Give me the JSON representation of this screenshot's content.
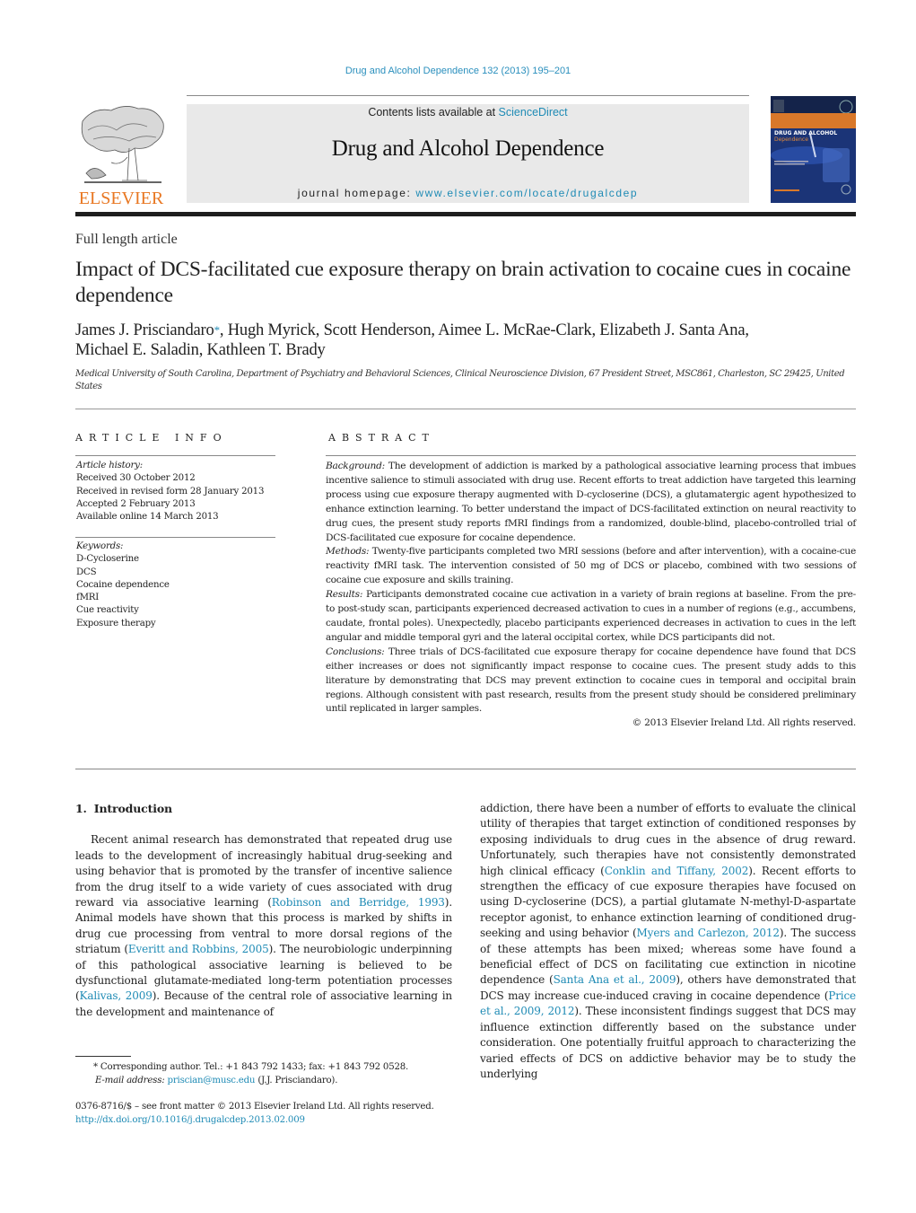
{
  "header": {
    "citation": "Drug and Alcohol Dependence 132 (2013) 195–201",
    "contents_prefix": "Contents lists available at ",
    "contents_link": "ScienceDirect",
    "journal_title": "Drug and Alcohol Dependence",
    "homepage_prefix": "journal homepage: ",
    "homepage_link": "www.elsevier.com/locate/drugalcdep",
    "publisher_logo_text": "ELSEVIER",
    "cover": {
      "title_line1": "DRUG AND ALCOHOL",
      "title_line2": "Dependence",
      "colors": {
        "band": "#d9782a",
        "background": "#13244a"
      }
    }
  },
  "article": {
    "type": "Full length article",
    "title": "Impact of DCS-facilitated cue exposure therapy on brain activation to cocaine cues in cocaine dependence",
    "authors": [
      {
        "name": "James J. Prisciandaro",
        "mark": "*"
      },
      {
        "name": "Hugh Myrick"
      },
      {
        "name": "Scott Henderson"
      },
      {
        "name": "Aimee L. McRae-Clark"
      },
      {
        "name": "Elizabeth J. Santa Ana"
      },
      {
        "name": "Michael E. Saladin"
      },
      {
        "name": "Kathleen T. Brady"
      }
    ],
    "affiliation": "Medical University of South Carolina, Department of Psychiatry and Behavioral Sciences, Clinical Neuroscience Division, 67 President Street, MSC861, Charleston, SC 29425, United States"
  },
  "article_info": {
    "heading": "ARTICLE INFO",
    "history_label": "Article history:",
    "history": [
      "Received 30 October 2012",
      "Received in revised form 28 January 2013",
      "Accepted 2 February 2013",
      "Available online 14 March 2013"
    ],
    "keywords_label": "Keywords:",
    "keywords": [
      "D-Cycloserine",
      "DCS",
      "Cocaine dependence",
      "fMRI",
      "Cue reactivity",
      "Exposure therapy"
    ]
  },
  "abstract": {
    "heading": "ABSTRACT",
    "sections": [
      {
        "label": "Background:",
        "text": " The development of addiction is marked by a pathological associative learning process that imbues incentive salience to stimuli associated with drug use. Recent efforts to treat addiction have targeted this learning process using cue exposure therapy augmented with D-cycloserine (DCS), a glutamatergic agent hypothesized to enhance extinction learning. To better understand the impact of DCS-facilitated extinction on neural reactivity to drug cues, the present study reports fMRI findings from a randomized, double-blind, placebo-controlled trial of DCS-facilitated cue exposure for cocaine dependence."
      },
      {
        "label": "Methods:",
        "text": " Twenty-five participants completed two MRI sessions (before and after intervention), with a cocaine-cue reactivity fMRI task. The intervention consisted of 50 mg of DCS or placebo, combined with two sessions of cocaine cue exposure and skills training."
      },
      {
        "label": "Results:",
        "text": " Participants demonstrated cocaine cue activation in a variety of brain regions at baseline. From the pre- to post-study scan, participants experienced decreased activation to cues in a number of regions (e.g., accumbens, caudate, frontal poles). Unexpectedly, placebo participants experienced decreases in activation to cues in the left angular and middle temporal gyri and the lateral occipital cortex, while DCS participants did not."
      },
      {
        "label": "Conclusions:",
        "text": " Three trials of DCS-facilitated cue exposure therapy for cocaine dependence have found that DCS either increases or does not significantly impact response to cocaine cues. The present study adds to this literature by demonstrating that DCS may prevent extinction to cocaine cues in temporal and occipital brain regions. Although consistent with past research, results from the present study should be considered preliminary until replicated in larger samples."
      }
    ],
    "copyright": "© 2013 Elsevier Ireland Ltd. All rights reserved."
  },
  "body": {
    "section_number": "1.",
    "section_title": "Introduction",
    "left_column": [
      {
        "t": "Recent animal research has demonstrated that repeated drug use leads to the development of increasingly habitual drug-seeking and using behavior that is promoted by the transfer of incentive salience from the drug itself to a wide variety of cues associated with drug reward via associative learning ("
      },
      {
        "ref": "Robinson and Berridge, 1993"
      },
      {
        "t": "). Animal models have shown that this process is marked by shifts in drug cue processing from ventral to more dorsal regions of the striatum ("
      },
      {
        "ref": "Everitt and Robbins, 2005"
      },
      {
        "t": "). The neurobiologic underpinning of this pathological associative learning is believed to be dysfunctional glutamate-mediated long-term potentiation processes ("
      },
      {
        "ref": "Kalivas, 2009"
      },
      {
        "t": "). Because of the central role of associative learning in the development and maintenance of"
      }
    ],
    "right_column": [
      {
        "t": "addiction, there have been a number of efforts to evaluate the clinical utility of therapies that target extinction of conditioned responses by exposing individuals to drug cues in the absence of drug reward. Unfortunately, such therapies have not consistently demonstrated high clinical efficacy ("
      },
      {
        "ref": "Conklin and Tiffany, 2002"
      },
      {
        "t": "). Recent efforts to strengthen the efficacy of cue exposure therapies have focused on using D-cycloserine (DCS), a partial glutamate N-methyl-D-aspartate receptor agonist, to enhance extinction learning of conditioned drug-seeking and using behavior ("
      },
      {
        "ref": "Myers and Carlezon, 2012"
      },
      {
        "t": "). The success of these attempts has been mixed; whereas some have found a beneficial effect of DCS on facilitating cue extinction in nicotine dependence ("
      },
      {
        "ref": "Santa Ana et al., 2009"
      },
      {
        "t": "), others have demonstrated that DCS may increase cue-induced craving in cocaine dependence ("
      },
      {
        "ref": "Price et al., 2009, 2012"
      },
      {
        "t": "). These inconsistent findings suggest that DCS may influence extinction differently based on the substance under consideration. One potentially fruitful approach to characterizing the varied effects of DCS on addictive behavior may be to study the underlying"
      }
    ]
  },
  "footnotes": {
    "corresponding": "* Corresponding author. Tel.: +1 843 792 1433; fax: +1 843 792 0528.",
    "email_label": "E-mail address:",
    "email": "priscian@musc.edu",
    "email_suffix": " (J.J. Prisciandaro).",
    "issn_line": "0376-8716/$ – see front matter © 2013 Elsevier Ireland Ltd. All rights reserved.",
    "doi": "http://dx.doi.org/10.1016/j.drugalcdep.2013.02.009"
  },
  "colors": {
    "link": "#1f8bb5",
    "elsevier_orange": "#e87722",
    "masthead_bg": "#e9e9e9"
  }
}
